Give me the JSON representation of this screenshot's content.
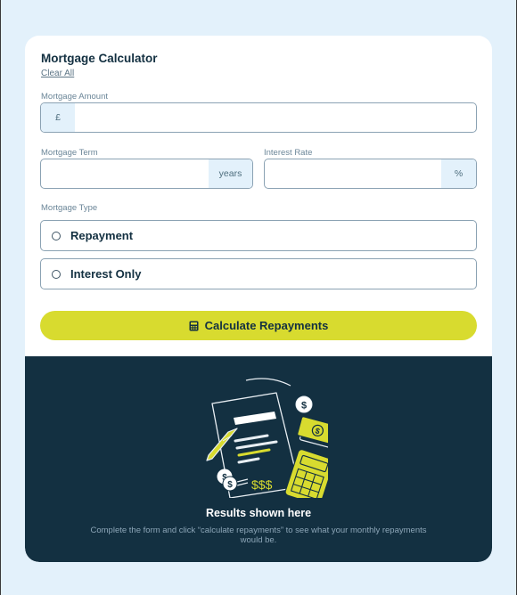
{
  "header": {
    "title": "Mortgage Calculator",
    "clear_label": "Clear All"
  },
  "form": {
    "amount": {
      "label": "Mortgage Amount",
      "prefix": "£",
      "value": ""
    },
    "term": {
      "label": "Mortgage Term",
      "suffix": "years",
      "value": ""
    },
    "rate": {
      "label": "Interest Rate",
      "suffix": "%",
      "value": ""
    },
    "type": {
      "label": "Mortgage Type",
      "options": [
        {
          "label": "Repayment",
          "selected": false
        },
        {
          "label": "Interest Only",
          "selected": false
        }
      ]
    },
    "submit_label": "Calculate Repayments"
  },
  "results": {
    "title": "Results shown here",
    "description": "Complete the form and click “calculate repayments” to see what your monthly repayments would be.",
    "illustration_dollar_text": "$$$"
  },
  "colors": {
    "page_bg": "#e3f1fb",
    "card_bg": "#ffffff",
    "dark_panel": "#133041",
    "accent_lime": "#d8db2f",
    "text_dark": "#133041",
    "text_muted": "#6b8698",
    "border": "#8ba2b3"
  },
  "icons": [
    "calculator-icon",
    "radio-circle-icon",
    "results-empty-illustration"
  ]
}
